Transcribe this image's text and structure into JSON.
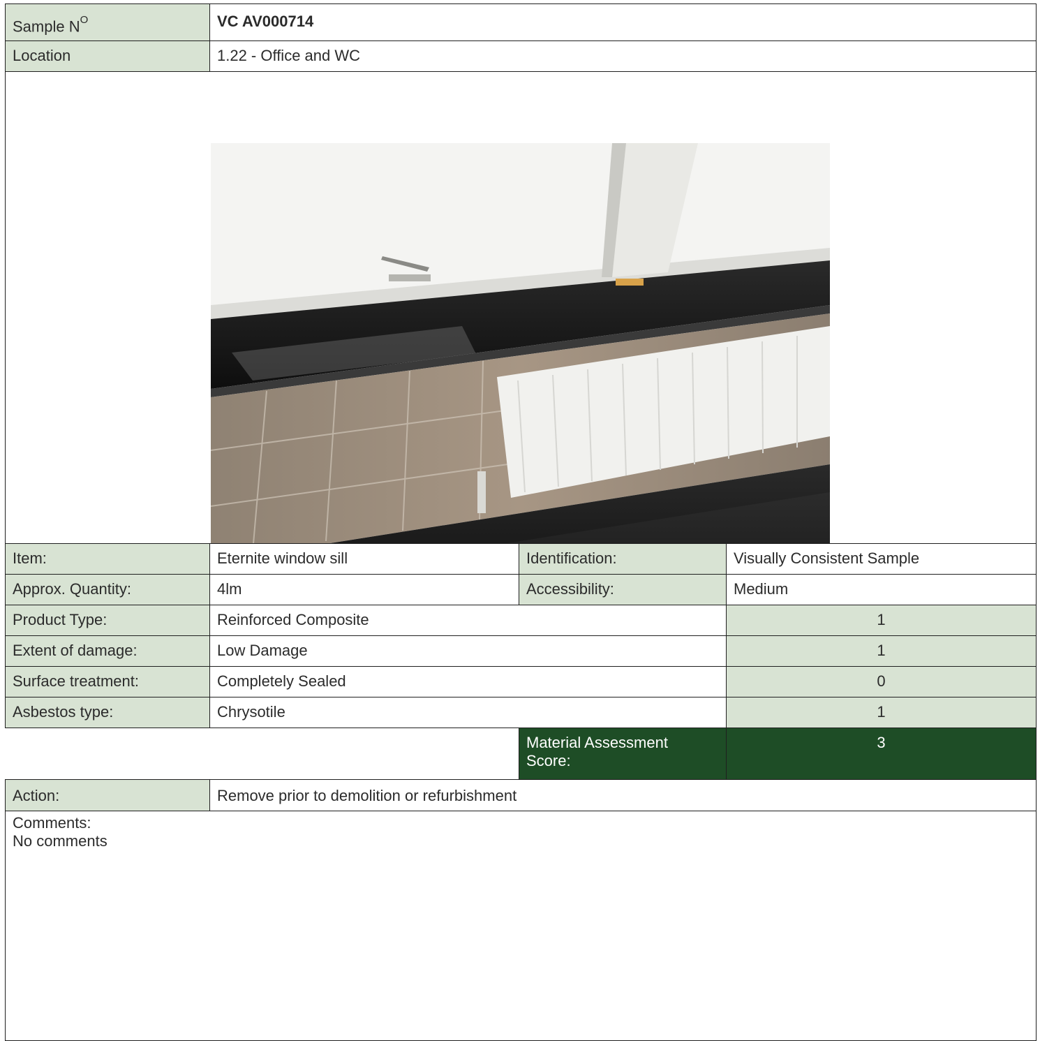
{
  "sample": {
    "label": "Sample N",
    "label_superscript": "O",
    "value": "VC AV000714"
  },
  "location": {
    "label": "Location",
    "value": "1.22 - Office and WC"
  },
  "photo": {
    "icon": "window-sill-photo"
  },
  "item": {
    "label": "Item:",
    "value": "Eternite window sill",
    "id_label": "Identification:",
    "id_value": "Visually Consistent Sample"
  },
  "quantity": {
    "label": "Approx. Quantity:",
    "value": "4lm",
    "access_label": "Accessibility:",
    "access_value": "Medium"
  },
  "assessment_rows": [
    {
      "label": "Product Type:",
      "value": "Reinforced Composite",
      "score": "1"
    },
    {
      "label": "Extent of damage:",
      "value": "Low Damage",
      "score": "1"
    },
    {
      "label": "Surface treatment:",
      "value": "Completely Sealed",
      "score": "0"
    },
    {
      "label": "Asbestos type:",
      "value": "Chrysotile",
      "score": "1"
    }
  ],
  "material_score": {
    "label": "Material Assessment Score:",
    "value": "3"
  },
  "action": {
    "label": "Action:",
    "value": "Remove prior to demolition or refurbishment"
  },
  "comments": {
    "label": "Comments:",
    "value": "No comments"
  },
  "colors": {
    "label_bg": "#d8e3d3",
    "score_bg": "#1e4d26",
    "border": "#1f1f1f"
  }
}
